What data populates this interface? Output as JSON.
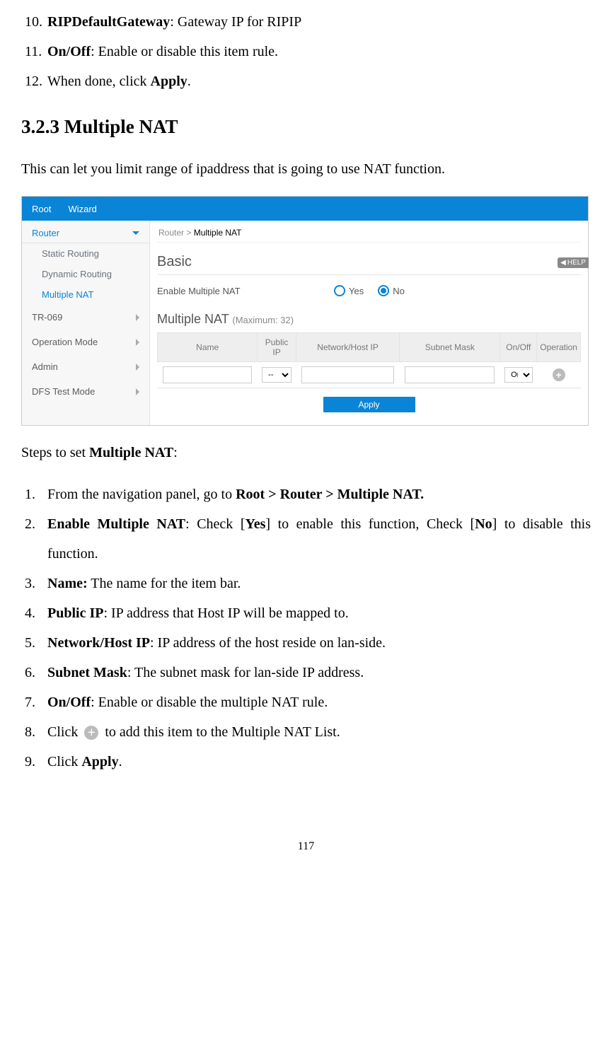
{
  "top_list": {
    "item10_label": "RIPDefaultGateway",
    "item10_text": ": Gateway IP for RIPIP",
    "item11_label": "On/Off",
    "item11_text": ": Enable or disable this item rule.",
    "item12_prefix": "When done, click ",
    "item12_bold": "Apply",
    "item12_suffix": "."
  },
  "section_heading": "3.2.3 Multiple NAT",
  "intro": "This can let you limit range of ipaddress that is going to use NAT function.",
  "ui": {
    "tabs": {
      "root": "Root",
      "wizard": "Wizard"
    },
    "sidebar": {
      "router": "Router",
      "static_routing": "Static Routing",
      "dynamic_routing": "Dynamic Routing",
      "multiple_nat": "Multiple NAT",
      "tr069": "TR-069",
      "operation_mode": "Operation Mode",
      "admin": "Admin",
      "dfs": "DFS Test Mode"
    },
    "breadcrumb_prefix": "Router > ",
    "breadcrumb_current": "Multiple NAT",
    "basic_title": "Basic",
    "help": "HELP",
    "enable_label": "Enable Multiple NAT",
    "yes": "Yes",
    "no": "No",
    "multi_title": "Multiple NAT",
    "multi_sub": "(Maximum: 32)",
    "cols": {
      "name": "Name",
      "public_ip": "Public IP",
      "network_host_ip": "Network/Host IP",
      "subnet_mask": "Subnet Mask",
      "onoff": "On/Off",
      "operation": "Operation"
    },
    "row": {
      "public_ip_default": "--",
      "onoff_default": "On"
    },
    "apply": "Apply"
  },
  "steps_intro_prefix": "Steps to set ",
  "steps_intro_bold": "Multiple NAT",
  "steps_intro_suffix": ":",
  "steps": {
    "s1_a": "From the navigation panel, go to ",
    "s1_b": "Root > Router > Multiple NAT.",
    "s2_a": "Enable Multiple NAT",
    "s2_b": ": Check [",
    "s2_c": "Yes",
    "s2_d": "] to enable this function, Check [",
    "s2_e": "No",
    "s2_f": "] to disable this function.",
    "s3_a": "Name:",
    "s3_b": " The name for the item bar.",
    "s4_a": "Public IP",
    "s4_b": ": IP address that Host IP will be mapped to.",
    "s5_a": "Network/Host IP",
    "s5_b": ": IP address of the host reside on lan-side.",
    "s6_a": "Subnet Mask",
    "s6_b": ": The subnet mask for lan-side IP address.",
    "s7_a": "On/Off",
    "s7_b": ": Enable or disable the multiple NAT rule.",
    "s8_a": "Click ",
    "s8_b": " to add this item to the Multiple NAT List.",
    "s9_a": "Click ",
    "s9_b": "Apply",
    "s9_c": "."
  },
  "page_number": "117"
}
